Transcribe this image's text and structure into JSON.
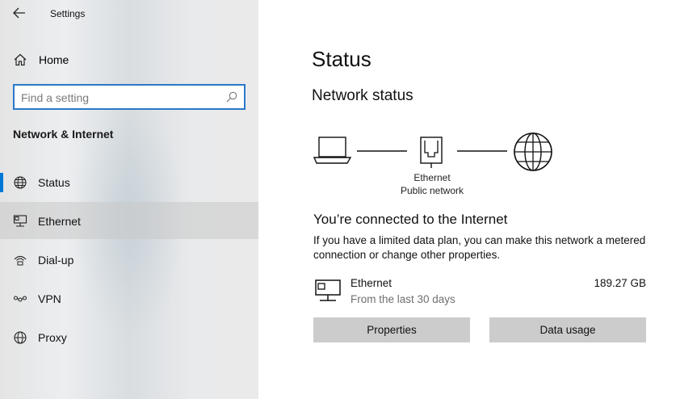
{
  "window": {
    "title": "Settings"
  },
  "sidebar": {
    "home_label": "Home",
    "search_placeholder": "Find a setting",
    "section_heading": "Network & Internet",
    "items": [
      {
        "label": "Status",
        "icon": "globe-icon",
        "selected": true
      },
      {
        "label": "Ethernet",
        "icon": "ethernet-icon",
        "hovered": true
      },
      {
        "label": "Dial-up",
        "icon": "dialup-icon"
      },
      {
        "label": "VPN",
        "icon": "vpn-icon"
      },
      {
        "label": "Proxy",
        "icon": "globe-icon"
      }
    ]
  },
  "main": {
    "title": "Status",
    "network_status_heading": "Network status",
    "diagram": {
      "adapter_name": "Ethernet",
      "network_type": "Public network"
    },
    "connected_heading": "You’re connected to the Internet",
    "connected_description": "If you have a limited data plan, you can make this network a metered connection or change other properties.",
    "adapter": {
      "name": "Ethernet",
      "period": "From the last 30 days",
      "usage": "189.27 GB"
    },
    "buttons": {
      "properties": "Properties",
      "data_usage": "Data usage"
    }
  },
  "colors": {
    "accent": "#0078d7",
    "search_border": "#2a78c8",
    "button_bg": "#cccccc"
  }
}
